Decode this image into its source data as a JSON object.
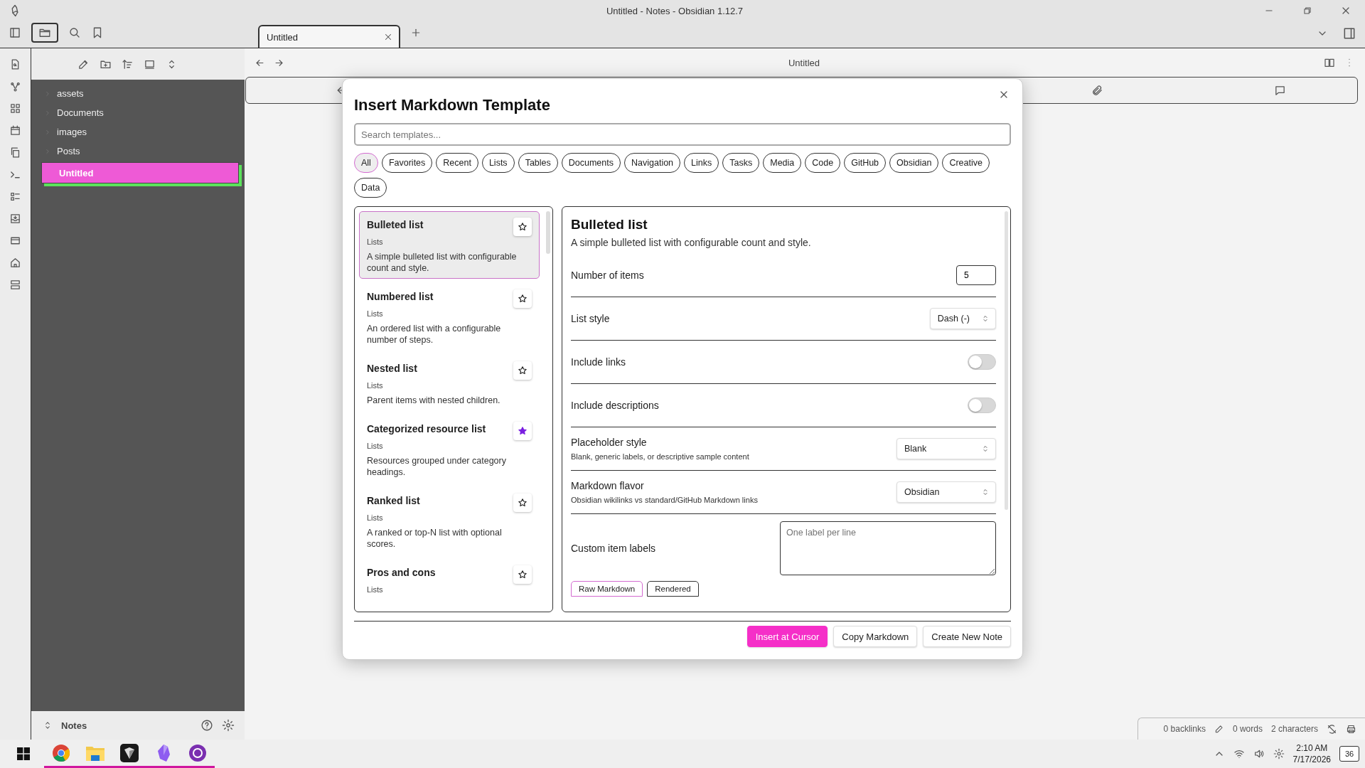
{
  "window": {
    "title": "Untitled - Notes - Obsidian 1.12.7"
  },
  "tabs": [
    {
      "label": "Untitled",
      "selected": true
    }
  ],
  "sidebar": {
    "items": [
      {
        "label": "assets",
        "kind": "folder",
        "selected": false
      },
      {
        "label": "Documents",
        "kind": "folder",
        "selected": false
      },
      {
        "label": "images",
        "kind": "folder",
        "selected": false
      },
      {
        "label": "Posts",
        "kind": "folder",
        "selected": false
      },
      {
        "label": "Untitled",
        "kind": "file",
        "selected": true
      }
    ],
    "vault": "Notes"
  },
  "editor": {
    "title": "Untitled"
  },
  "dialog": {
    "title": "Insert Markdown Template",
    "search": {
      "placeholder": "Search templates..."
    },
    "filters": [
      {
        "label": "All",
        "selected": true
      },
      {
        "label": "Favorites",
        "selected": false
      },
      {
        "label": "Recent",
        "selected": false
      },
      {
        "label": "Lists",
        "selected": false
      },
      {
        "label": "Tables",
        "selected": false
      },
      {
        "label": "Documents",
        "selected": false
      },
      {
        "label": "Navigation",
        "selected": false
      },
      {
        "label": "Links",
        "selected": false
      },
      {
        "label": "Tasks",
        "selected": false
      },
      {
        "label": "Media",
        "selected": false
      },
      {
        "label": "Code",
        "selected": false
      },
      {
        "label": "GitHub",
        "selected": false
      },
      {
        "label": "Obsidian",
        "selected": false
      },
      {
        "label": "Creative",
        "selected": false
      },
      {
        "label": "Data",
        "selected": false
      }
    ],
    "templates": [
      {
        "name": "Bulleted list",
        "category": "Lists",
        "description": "A simple bulleted list with configurable count and style.",
        "selected": true,
        "favorite": false
      },
      {
        "name": "Numbered list",
        "category": "Lists",
        "description": "An ordered list with a configurable number of steps.",
        "selected": false,
        "favorite": false
      },
      {
        "name": "Nested list",
        "category": "Lists",
        "description": "Parent items with nested children.",
        "selected": false,
        "favorite": false
      },
      {
        "name": "Categorized resource list",
        "category": "Lists",
        "description": "Resources grouped under category headings.",
        "selected": false,
        "favorite": true
      },
      {
        "name": "Ranked list",
        "category": "Lists",
        "description": "A ranked or top-N list with optional scores.",
        "selected": false,
        "favorite": false
      },
      {
        "name": "Pros and cons",
        "category": "Lists",
        "selected": false,
        "favorite": false
      }
    ],
    "detail": {
      "title": "Bulleted list",
      "description": "A simple bulleted list with configurable count and style.",
      "options": [
        {
          "kind": "number",
          "label": "Number of items",
          "value": "5"
        },
        {
          "kind": "select",
          "label": "List style",
          "value": "Dash (-)"
        },
        {
          "kind": "toggle",
          "label": "Include links",
          "on": false
        },
        {
          "kind": "toggle",
          "label": "Include descriptions",
          "on": false
        },
        {
          "kind": "select",
          "label": "Placeholder style",
          "hint": "Blank, generic labels, or descriptive sample content",
          "value": "Blank"
        },
        {
          "kind": "select",
          "label": "Markdown flavor",
          "hint": "Obsidian wikilinks vs standard/GitHub Markdown links",
          "value": "Obsidian"
        },
        {
          "kind": "textarea",
          "label": "Custom item labels",
          "placeholder": "One label per line"
        }
      ],
      "view_tabs": [
        {
          "label": "Raw Markdown",
          "selected": true
        },
        {
          "label": "Rendered",
          "selected": false
        }
      ]
    },
    "buttons": [
      {
        "label": "Insert at Cursor",
        "kind": "primary"
      },
      {
        "label": "Copy Markdown",
        "kind": "secondary"
      },
      {
        "label": "Create New Note",
        "kind": "secondary"
      }
    ]
  },
  "status_bar": {
    "backlinks": "0 backlinks",
    "words": "0 words",
    "characters": "2 characters"
  },
  "taskbar": {
    "time": "2:10 AM",
    "date": "7/17/2026",
    "notifications": "36"
  }
}
